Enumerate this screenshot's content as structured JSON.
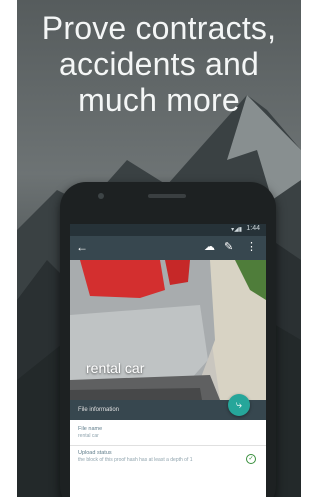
{
  "headline": {
    "lines": [
      "Prove contracts,",
      "accidents and",
      "much more"
    ]
  },
  "phone": {
    "status": {
      "signal": "▾◢▮",
      "time": "1:44"
    },
    "appbar": {
      "back_icon": "arrow-back-icon",
      "actions": [
        "cloud-upload-icon",
        "edit-icon",
        "more-vert-icon"
      ]
    },
    "photo_caption": "rental car",
    "share_icon": "share-icon",
    "section_title": "File information",
    "fields": [
      {
        "label": "File name",
        "value": "rental car"
      },
      {
        "label": "Upload status",
        "value": "the block of this proof hash has at least a depth of 1"
      }
    ]
  }
}
